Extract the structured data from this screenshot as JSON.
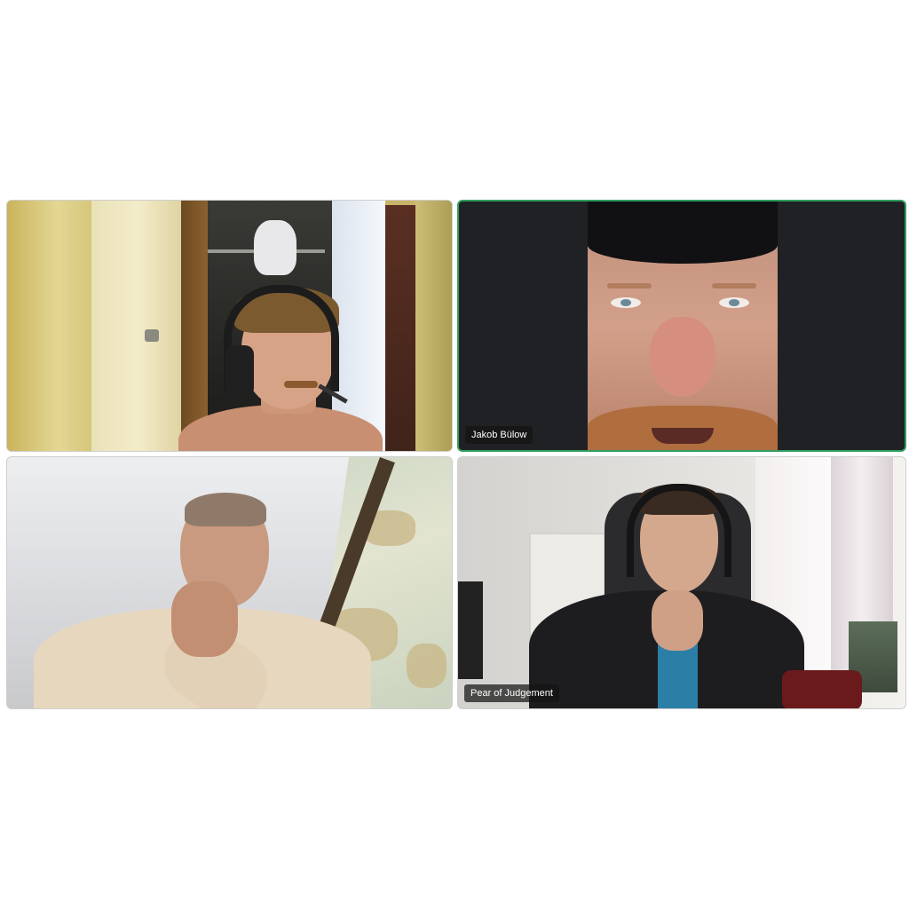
{
  "participants": [
    {
      "name": "",
      "active": false
    },
    {
      "name": "Jakob Bülow",
      "active": true
    },
    {
      "name": "",
      "active": false
    },
    {
      "name": "Pear of Judgement",
      "active": false
    }
  ],
  "colors": {
    "active_speaker_border": "#2f9e60",
    "name_tag_bg": "#141414",
    "background": "#ffffff"
  }
}
